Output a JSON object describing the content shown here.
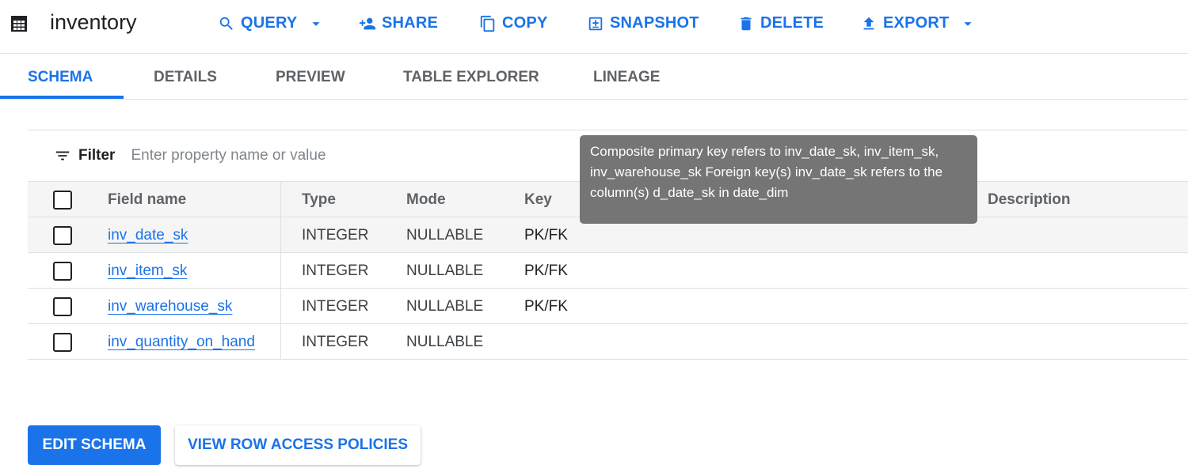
{
  "header": {
    "title": "inventory",
    "actions": [
      {
        "label": "QUERY",
        "icon": "search-icon",
        "dropdown": true
      },
      {
        "label": "SHARE",
        "icon": "person-add-icon"
      },
      {
        "label": "COPY",
        "icon": "copy-icon"
      },
      {
        "label": "SNAPSHOT",
        "icon": "snapshot-icon"
      },
      {
        "label": "DELETE",
        "icon": "trash-icon"
      },
      {
        "label": "EXPORT",
        "icon": "upload-icon",
        "dropdown": true
      }
    ]
  },
  "tabs": [
    {
      "label": "SCHEMA",
      "active": true
    },
    {
      "label": "DETAILS"
    },
    {
      "label": "PREVIEW"
    },
    {
      "label": "TABLE EXPLORER"
    },
    {
      "label": "LINEAGE"
    }
  ],
  "filter": {
    "label": "Filter",
    "placeholder": "Enter property name or value"
  },
  "table": {
    "columns": [
      "Field name",
      "Type",
      "Mode",
      "Key",
      "Description"
    ],
    "rows": [
      {
        "name": "inv_date_sk",
        "type": "INTEGER",
        "mode": "NULLABLE",
        "key": "PK/FK"
      },
      {
        "name": "inv_item_sk",
        "type": "INTEGER",
        "mode": "NULLABLE",
        "key": "PK/FK"
      },
      {
        "name": "inv_warehouse_sk",
        "type": "INTEGER",
        "mode": "NULLABLE",
        "key": "PK/FK"
      },
      {
        "name": "inv_quantity_on_hand",
        "type": "INTEGER",
        "mode": "NULLABLE",
        "key": ""
      }
    ]
  },
  "tooltip": "Composite primary key refers to inv_date_sk, inv_item_sk, inv_warehouse_sk Foreign key(s) inv_date_sk refers to the column(s) d_date_sk in date_dim",
  "buttons": {
    "edit_schema": "EDIT SCHEMA",
    "row_access": "VIEW ROW ACCESS POLICIES"
  },
  "colors": {
    "accent": "#1a73e8",
    "tooltip_bg": "#757575"
  }
}
